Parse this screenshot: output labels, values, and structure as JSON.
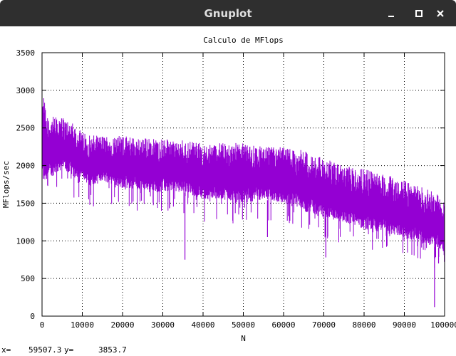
{
  "window": {
    "title": "Gnuplot",
    "controls": [
      "minimize-icon",
      "maximize-icon",
      "close-icon"
    ]
  },
  "status": {
    "x_label": "x=",
    "x_value": "59507.3",
    "y_label": "y=",
    "y_value": "3853.7"
  },
  "colors": {
    "series": "#9400d3",
    "titlebar": "#2f2f2f",
    "grid": "#000000"
  },
  "chart_data": {
    "type": "line",
    "title": "Calculo de MFlops",
    "xlabel": "N",
    "ylabel": "MFlops/sec",
    "xlim": [
      0,
      100000
    ],
    "ylim": [
      0,
      3500
    ],
    "grid": true,
    "legend": "none",
    "x_ticks": [
      0,
      10000,
      20000,
      30000,
      40000,
      50000,
      60000,
      70000,
      80000,
      90000,
      100000
    ],
    "x_tick_labels": [
      "0",
      "10000",
      "20000",
      "30000",
      "40000",
      "50000",
      "60000",
      "70000",
      "80000",
      "90000",
      "100000"
    ],
    "y_ticks": [
      0,
      500,
      1000,
      1500,
      2000,
      2500,
      3000,
      3500
    ],
    "y_tick_labels": [
      "0",
      "500",
      "1000",
      "1500",
      "2000",
      "2500",
      "3000",
      "3500"
    ],
    "series": [
      {
        "color": "#9400d3",
        "envelope": {
          "x": [
            0,
            500,
            1000,
            5000,
            8000,
            10000,
            12000,
            15000,
            20000,
            30000,
            35000,
            40000,
            45000,
            50000,
            55000,
            60000,
            65000,
            70000,
            75000,
            80000,
            85000,
            90000,
            95000,
            99000,
            100000
          ],
          "upper": [
            2750,
            3000,
            2650,
            2650,
            2550,
            2450,
            2400,
            2400,
            2400,
            2350,
            2350,
            2300,
            2300,
            2300,
            2250,
            2250,
            2200,
            2100,
            2000,
            1950,
            1900,
            1800,
            1700,
            1600,
            1550
          ],
          "lower": [
            1800,
            1750,
            1800,
            1950,
            1850,
            1850,
            1700,
            1800,
            1700,
            1650,
            1650,
            1550,
            1550,
            1500,
            1550,
            1500,
            1400,
            1300,
            1250,
            1150,
            1100,
            1050,
            950,
            900,
            850
          ]
        },
        "notable_dips": [
          {
            "x": 35500,
            "y": 750
          },
          {
            "x": 70500,
            "y": 780
          },
          {
            "x": 97500,
            "y": 120
          },
          {
            "x": 98500,
            "y": 700
          },
          {
            "x": 56000,
            "y": 1050
          }
        ]
      }
    ]
  }
}
